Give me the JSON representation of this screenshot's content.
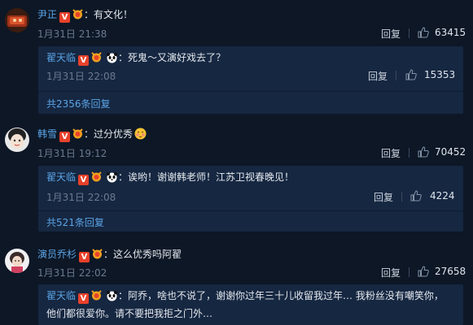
{
  "comments": [
    {
      "user": "尹正",
      "text": "：有文化！",
      "date": "1月31日 21:38",
      "reply_label": "回复",
      "likes": "63415",
      "reply": {
        "user": "翟天临",
        "text": "：死鬼～又演好戏去了？",
        "date": "1月31日 22:08",
        "reply_label": "回复",
        "likes": "15353"
      },
      "more": "共2356条回复"
    },
    {
      "user": "韩雪",
      "text": "：过分优秀",
      "date": "1月31日 19:12",
      "reply_label": "回复",
      "likes": "70452",
      "reply": {
        "user": "翟天临",
        "text": "：诶哟！谢谢韩老师！江苏卫视春晚见！",
        "date": "1月31日 22:08",
        "reply_label": "回复",
        "likes": "4224"
      },
      "more": "共521条回复"
    },
    {
      "user": "演员乔杉",
      "text": "：这么优秀吗阿翟",
      "date": "1月31日 22:02",
      "reply_label": "回复",
      "likes": "27658",
      "reply": {
        "user": "翟天临",
        "text": "：阿乔，啥也不说了，谢谢你过年三十儿收留我过年… 我粉丝没有嘲笑你，",
        "text2": "他们都很爱你。请不要把我拒之门外…"
      }
    }
  ],
  "badge_letter": "V",
  "colors": {
    "background": "#0d1726",
    "reply_bg": "#162741",
    "username": "#5ba4e6",
    "badge": "#e8412b"
  },
  "icons": [
    "verified-v-icon",
    "vip-medal-icon",
    "panda-icon",
    "thumb-up-icon",
    "blush-emoji-icon"
  ]
}
